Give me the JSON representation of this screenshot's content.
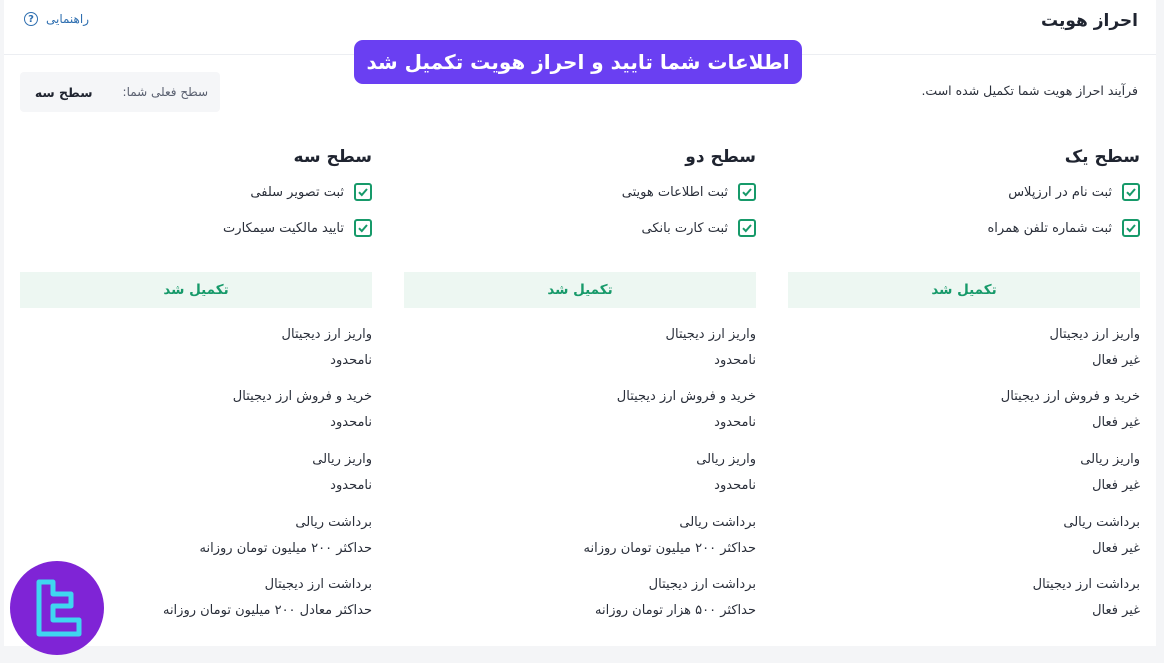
{
  "header": {
    "title": "احراز هویت",
    "help_label": "راهنمایی",
    "help_icon": "question-circle-icon"
  },
  "banner": {
    "text": "اطلاعات شما تایید و احراز هویت تکمیل شد",
    "color": "#6a3ff2"
  },
  "status_text": "فرآیند احراز هویت شما تکمیل شده است.",
  "current_level": {
    "label": "سطح فعلی شما:",
    "value": "سطح سه"
  },
  "levels": [
    {
      "title": "سطح یک",
      "requirements": [
        "ثبت نام در ارزپلاس",
        "ثبت شماره تلفن همراه"
      ],
      "status": "تکمیل شد",
      "permissions": [
        {
          "label": "واریز ارز دیجیتال",
          "value": "غیر فعال"
        },
        {
          "label": "خرید و فروش ارز دیجیتال",
          "value": "غیر فعال"
        },
        {
          "label": "واریز ریالی",
          "value": "غیر فعال"
        },
        {
          "label": "برداشت ریالی",
          "value": "غیر فعال"
        },
        {
          "label": "برداشت ارز دیجیتال",
          "value": "غیر فعال"
        }
      ]
    },
    {
      "title": "سطح دو",
      "requirements": [
        "ثبت اطلاعات هویتی",
        "ثبت کارت بانکی"
      ],
      "status": "تکمیل شد",
      "permissions": [
        {
          "label": "واریز ارز دیجیتال",
          "value": "نامحدود"
        },
        {
          "label": "خرید و فروش ارز دیجیتال",
          "value": "نامحدود"
        },
        {
          "label": "واریز ریالی",
          "value": "نامحدود"
        },
        {
          "label": "برداشت ریالی",
          "value": "حداکثر ۲۰۰ میلیون تومان روزانه"
        },
        {
          "label": "برداشت ارز دیجیتال",
          "value": "حداکثر ۵۰۰ هزار تومان روزانه"
        }
      ]
    },
    {
      "title": "سطح سه",
      "requirements": [
        "ثبت تصویر سلفی",
        "تایید مالکیت سیمکارت"
      ],
      "status": "تکمیل شد",
      "permissions": [
        {
          "label": "واریز ارز دیجیتال",
          "value": "نامحدود"
        },
        {
          "label": "خرید و فروش ارز دیجیتال",
          "value": "نامحدود"
        },
        {
          "label": "واریز ریالی",
          "value": "نامحدود"
        },
        {
          "label": "برداشت ریالی",
          "value": "حداکثر ۲۰۰ میلیون تومان روزانه"
        },
        {
          "label": "برداشت ارز دیجیتال",
          "value": "حداکثر معادل ۲۰۰ میلیون تومان روزانه"
        }
      ]
    }
  ],
  "colors": {
    "check": "#179a6a",
    "status_bg": "#edf7f2",
    "logo_bg": "#7f24d6",
    "logo_fg": "#3fd6f0"
  },
  "logo_icon": "brand-logo-icon"
}
